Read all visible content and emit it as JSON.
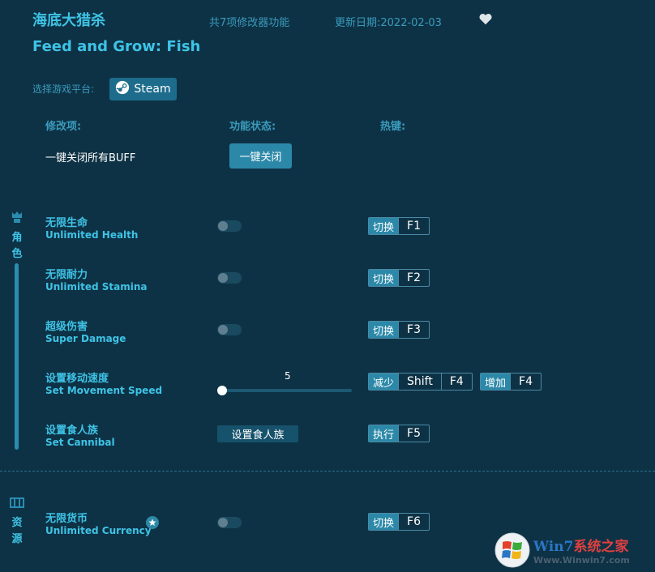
{
  "header": {
    "title_cn": "海底大猎杀",
    "title_en": "Feed and Grow: Fish",
    "feature_count": "共7项修改器功能",
    "update_date": "更新日期:2022-02-03",
    "favorite_icon": "heart-icon"
  },
  "platform": {
    "label": "选择游戏平台:",
    "button_label": "Steam",
    "icon": "steam-icon"
  },
  "columns": {
    "item": "修改项:",
    "status": "功能状态:",
    "hotkey": "热键:"
  },
  "all_off": {
    "label": "一键关闭所有BUFF",
    "button": "一键关闭"
  },
  "categories": {
    "character": {
      "char1": "角",
      "char2": "色",
      "icon": "character-icon"
    },
    "resources": {
      "char1": "资",
      "char2": "源",
      "icon": "resources-icon"
    }
  },
  "rows": {
    "health": {
      "cn": "无限生命",
      "en": "Unlimited Health",
      "on": false,
      "action": "切换",
      "key": "F1"
    },
    "stamina": {
      "cn": "无限耐力",
      "en": "Unlimited Stamina",
      "on": false,
      "action": "切换",
      "key": "F2"
    },
    "damage": {
      "cn": "超级伤害",
      "en": "Super Damage",
      "on": false,
      "action": "切换",
      "key": "F3"
    },
    "speed": {
      "cn": "设置移动速度",
      "en": "Set Movement Speed",
      "value": "5",
      "dec_action": "减少",
      "dec_mod": "Shift",
      "dec_key": "F4",
      "inc_action": "增加",
      "inc_key": "F4"
    },
    "cannibal": {
      "cn": "设置食人族",
      "en": "Set Cannibal",
      "button": "设置食人族",
      "action": "执行",
      "key": "F5"
    },
    "currency": {
      "cn": "无限货币",
      "en": "Unlimited Currency",
      "on": false,
      "action": "切换",
      "key": "F6",
      "badge_icon": "star-icon"
    }
  },
  "watermark": {
    "brand_main": "Win7",
    "brand_rest": "系统之家",
    "url": "Www.Winwin7.com"
  },
  "colors": {
    "background": "#0e3245",
    "accent": "#3ec3e6",
    "muted": "#3a9bbd",
    "button": "#2c88a8"
  }
}
